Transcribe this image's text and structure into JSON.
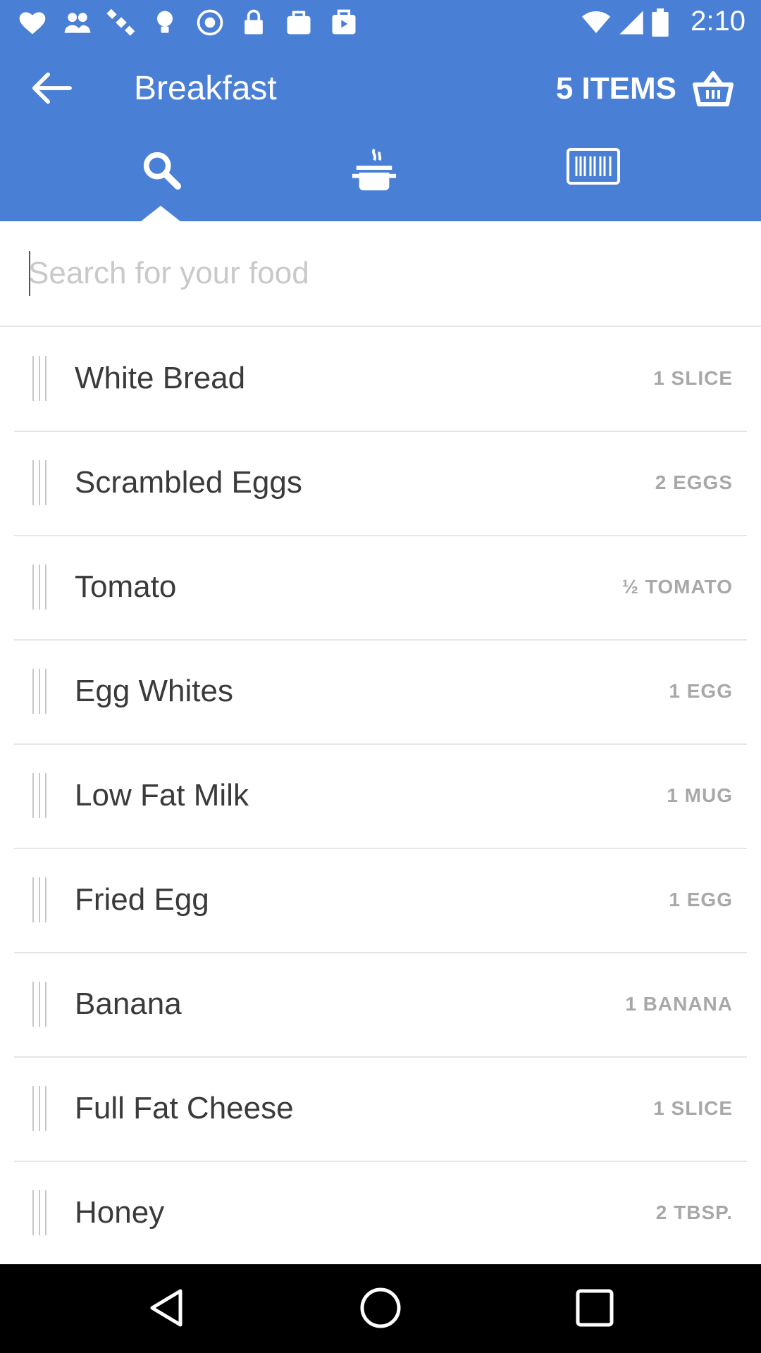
{
  "status_bar": {
    "time": "2:10",
    "left_icons": [
      "heart-icon",
      "people-icon",
      "satellite-icon",
      "bulb-icon",
      "radio-icon",
      "lock-icon",
      "bag-icon",
      "play-icon"
    ]
  },
  "header": {
    "title": "Breakfast",
    "items_label": "5 ITEMS",
    "tabs": [
      {
        "name": "search-tab",
        "icon": "search-icon",
        "selected": true
      },
      {
        "name": "recipe-tab",
        "icon": "pot-icon",
        "selected": false
      },
      {
        "name": "barcode-tab",
        "icon": "barcode-icon",
        "selected": false
      }
    ]
  },
  "search": {
    "placeholder": "Search for your food",
    "value": ""
  },
  "foods": [
    {
      "name": "White Bread",
      "qty": "1 SLICE"
    },
    {
      "name": "Scrambled Eggs",
      "qty": "2 EGGS"
    },
    {
      "name": "Tomato",
      "qty": "½ TOMATO"
    },
    {
      "name": "Egg Whites",
      "qty": "1 EGG"
    },
    {
      "name": "Low Fat Milk",
      "qty": "1 MUG"
    },
    {
      "name": "Fried Egg",
      "qty": "1 EGG"
    },
    {
      "name": "Banana",
      "qty": "1 BANANA"
    },
    {
      "name": "Full Fat Cheese",
      "qty": "1 SLICE"
    },
    {
      "name": "Honey",
      "qty": "2 TBSP."
    }
  ],
  "colors": {
    "header": "#4a7fd6",
    "text": "#3a3a3a",
    "qty": "#a8a8a8"
  }
}
